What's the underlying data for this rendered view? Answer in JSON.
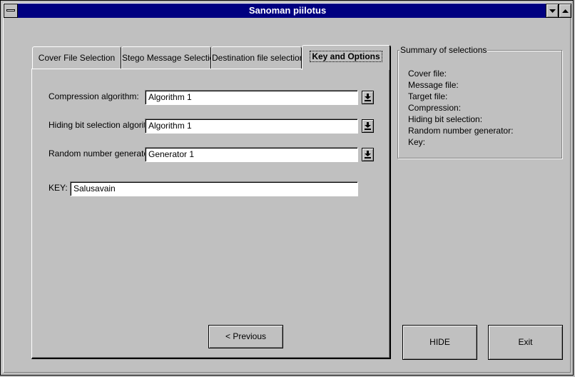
{
  "window": {
    "title": "Sanoman piilotus"
  },
  "tabs": [
    {
      "label": "Cover File Selection"
    },
    {
      "label": "Stego Message Selection"
    },
    {
      "label": "Destination file selection"
    },
    {
      "label": "Key and Options"
    }
  ],
  "options": {
    "compression_label": "Compression algorithm:",
    "compression_value": "Algorithm 1",
    "hiding_label": "Hiding bit selection algoritm:",
    "hiding_value": "Algorithm 1",
    "random_label": "Random number generator:",
    "random_value": "Generator 1",
    "key_label": "KEY:",
    "key_value": "Salusavain",
    "previous_label": "< Previous"
  },
  "summary": {
    "title": "Summary of selections",
    "items": [
      "Cover file:",
      "Message file:",
      "Target file:",
      "Compression:",
      "Hiding bit selection:",
      "Random number generator:",
      "Key:"
    ]
  },
  "buttons": {
    "hide": "HIDE",
    "exit": "Exit"
  }
}
